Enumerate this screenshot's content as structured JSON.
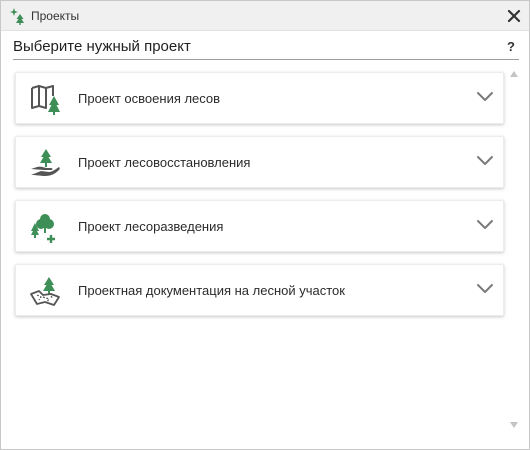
{
  "window": {
    "title": "Проекты",
    "title_icon": "forest-sparkle-icon",
    "close_icon": "close-icon"
  },
  "header": {
    "title": "Выберите нужный проект",
    "help_label": "?"
  },
  "projects": [
    {
      "label": "Проект освоения лесов",
      "icon": "map-tree-icon"
    },
    {
      "label": "Проект лесовосстановления",
      "icon": "hand-tree-icon"
    },
    {
      "label": "Проект лесоразведения",
      "icon": "trees-plus-icon"
    },
    {
      "label": "Проектная документация на лесной участок",
      "icon": "land-plot-tree-icon"
    }
  ],
  "colors": {
    "accent_green": "#3e8e57",
    "icon_gray": "#555555",
    "chevron_gray": "#7a7a7a"
  }
}
